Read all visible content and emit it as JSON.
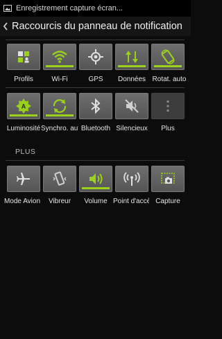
{
  "status_bar": {
    "notification": "Enregistrement capture écran..."
  },
  "header": {
    "title": "Raccourcis du panneau de notification"
  },
  "section": {
    "title": "PLUS"
  },
  "row1": [
    {
      "label": "Profils",
      "icon": "profiles-icon",
      "on": false
    },
    {
      "label": "Wi-Fi",
      "icon": "wifi-icon",
      "on": true
    },
    {
      "label": "GPS",
      "icon": "gps-icon",
      "on": false
    },
    {
      "label": "Données",
      "icon": "data-icon",
      "on": true
    },
    {
      "label": "Rotat. auto",
      "icon": "rotate-icon",
      "on": true
    }
  ],
  "row2": [
    {
      "label": "Luminosité",
      "icon": "brightness-icon",
      "on": true
    },
    {
      "label": "Synchro. auto",
      "icon": "sync-icon",
      "on": true
    },
    {
      "label": "Bluetooth",
      "icon": "bluetooth-icon",
      "on": false
    },
    {
      "label": "Silencieux",
      "icon": "silent-icon",
      "on": false
    },
    {
      "label": "Plus",
      "icon": "more-icon",
      "on": false
    }
  ],
  "row3": [
    {
      "label": "Mode Avion",
      "icon": "airplane-icon",
      "on": false
    },
    {
      "label": "Vibreur",
      "icon": "vibrate-icon",
      "on": false
    },
    {
      "label": "Volume",
      "icon": "volume-icon",
      "on": true
    },
    {
      "label": "Point d'accès",
      "icon": "hotspot-icon",
      "on": false
    },
    {
      "label": "Capture",
      "icon": "screenshot-icon",
      "on": false
    }
  ],
  "colors": {
    "accent": "#9ad21b",
    "tile": "#606060",
    "background": "#0c0c0c"
  }
}
